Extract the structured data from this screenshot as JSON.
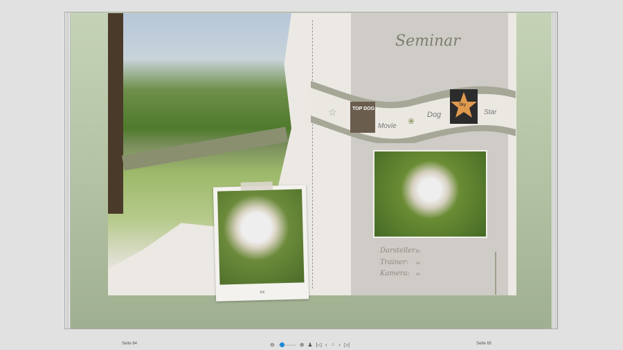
{
  "left_page": {
    "polaroid_caption": "xx"
  },
  "right_page": {
    "title": "Seminar",
    "film_labels": [
      "Movie",
      "Dog",
      "Star"
    ],
    "film_images": {
      "poster": "TOP DOG",
      "star": "Sky"
    },
    "credits": [
      {
        "label": "Darsteller:",
        "value": "xx"
      },
      {
        "label": "Trainer:",
        "value": "xx"
      },
      {
        "label": "Kamera:",
        "value": "xx"
      }
    ]
  },
  "footer": {
    "left_page_label": "Seite 64",
    "right_page_label": "Seite 65",
    "zoom_level": 0.1
  },
  "colors": {
    "accent": "#1a8ad6",
    "frame": "#b4c3a4",
    "panel": "#cfcbc7"
  }
}
